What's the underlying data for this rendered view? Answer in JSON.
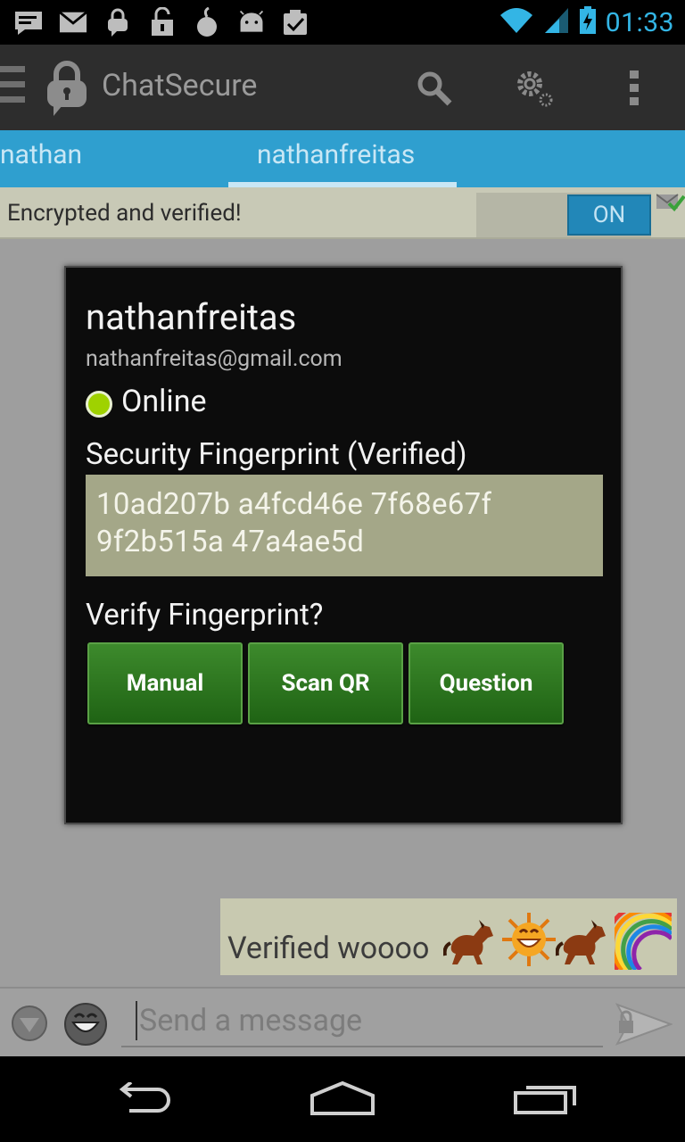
{
  "status_bar": {
    "time": "01:33",
    "notification_icons": [
      "message-icon",
      "mail-icon",
      "chat-bubble-lock-icon",
      "unlock-icon",
      "onion-icon",
      "android-icon",
      "checkbox-icon"
    ],
    "system_icons": [
      "wifi-icon",
      "signal-icon",
      "battery-charging-icon"
    ]
  },
  "action_bar": {
    "title": "ChatSecure",
    "actions": [
      "search-icon",
      "settings-icon",
      "overflow-menu-icon"
    ]
  },
  "tabs": [
    {
      "label": "nathan",
      "selected": false
    },
    {
      "label": "nathanfreitas",
      "selected": true
    }
  ],
  "encryption": {
    "status_text": "Encrypted and verified!",
    "toggle_label": "ON"
  },
  "contact_dialog": {
    "name": "nathanfreitas",
    "email": "nathanfreitas@gmail.com",
    "presence": "Online",
    "fingerprint_label": "Security Fingerprint (Verified)",
    "fingerprint_line1": "10ad207b a4fcd46e 7f68e67f",
    "fingerprint_line2": "9f2b515a 47a4ae5d",
    "verify_prompt": "Verify Fingerprint?",
    "buttons": {
      "manual": "Manual",
      "scan_qr": "Scan QR",
      "question": "Question"
    }
  },
  "messages": [
    {
      "text": "Verified woooo",
      "emoji": [
        "horse-emoji",
        "grinning-sun-emoji",
        "horse-emoji",
        "rainbow-emoji"
      ]
    }
  ],
  "compose": {
    "placeholder": "Send a message"
  },
  "colors": {
    "tab_bar": "#2f9fcf",
    "action_bar": "#2d2d2d",
    "verify_button": "#2e7a20",
    "fingerprint_box": "#a4a788",
    "online": "#9fd200",
    "clock": "#33b5e5"
  }
}
